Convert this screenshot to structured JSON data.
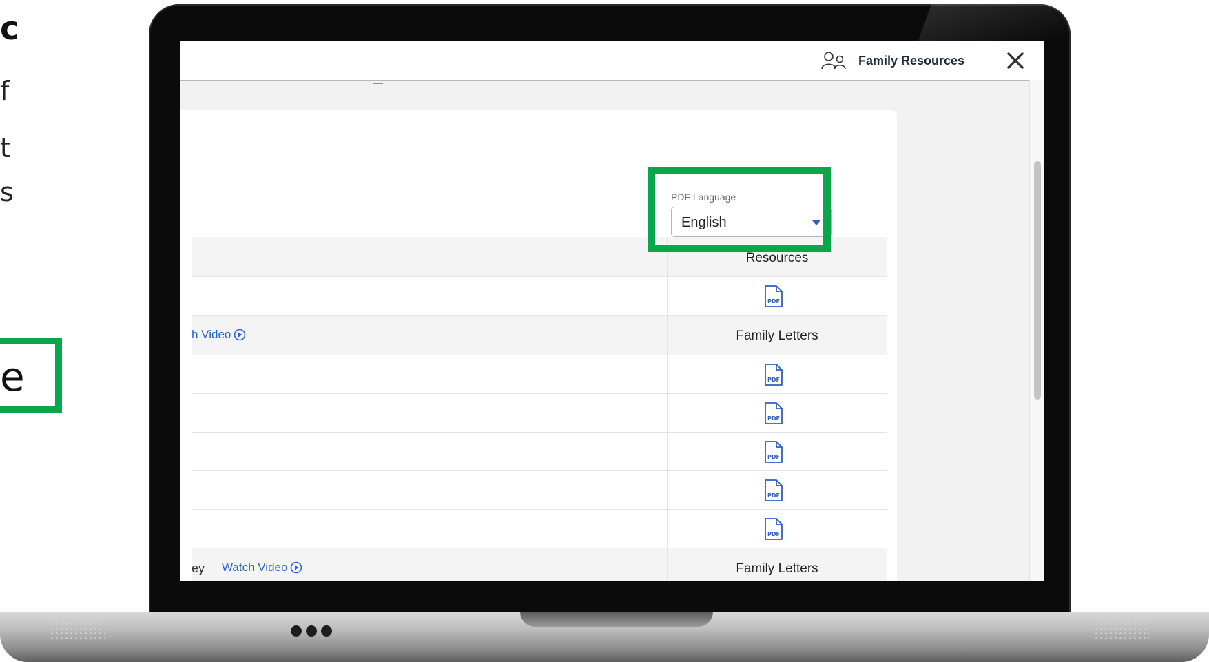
{
  "slide": {
    "fragments": [
      "c",
      "f",
      "t",
      "s",
      "e"
    ]
  },
  "app": {
    "header": {
      "title": "Family Resources",
      "profile_icon": "family-users-icon",
      "close_icon": "close-icon"
    },
    "pdf_language": {
      "label": "PDF Language",
      "value": "English"
    },
    "table": {
      "header_resources": "Resources",
      "rows": [
        {
          "type": "pdf"
        },
        {
          "type": "section",
          "left_fragment": "h Video",
          "resources_text": "Family Letters"
        },
        {
          "type": "pdf"
        },
        {
          "type": "pdf"
        },
        {
          "type": "pdf"
        },
        {
          "type": "pdf"
        },
        {
          "type": "pdf"
        },
        {
          "type": "section",
          "left_fragment": "ey",
          "video_link": "Watch Video",
          "resources_text": "Family Letters"
        }
      ],
      "pdf_label": "PDF"
    }
  },
  "colors": {
    "highlight": "#0aa74a",
    "link": "#2d63c8",
    "pdf_icon": "#2f5fc0"
  }
}
